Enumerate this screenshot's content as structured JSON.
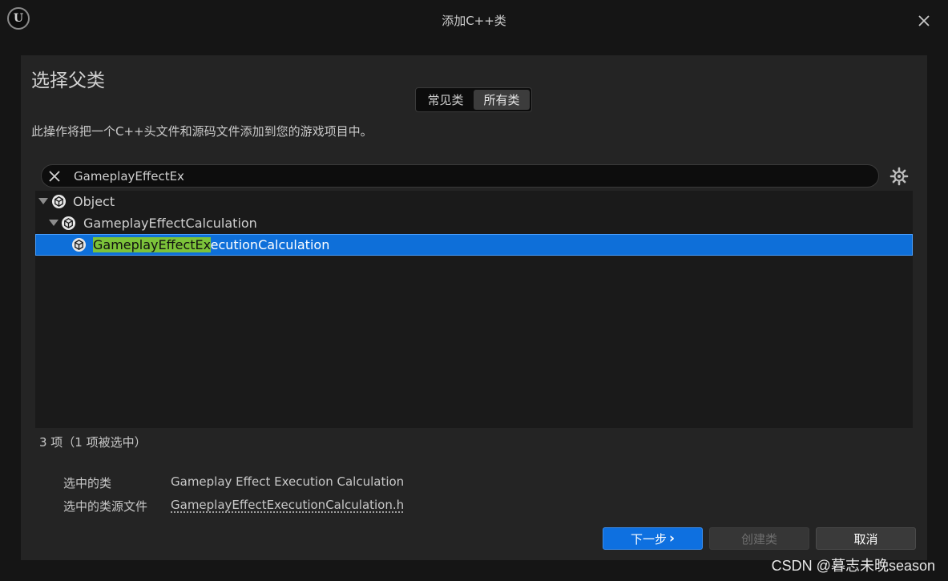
{
  "window": {
    "title": "添加C++类",
    "logo_text": "U"
  },
  "dialog": {
    "heading": "选择父类",
    "tabs": [
      {
        "label": "常见类",
        "active": false
      },
      {
        "label": "所有类",
        "active": true
      }
    ],
    "description": "此操作将把一个C++头文件和源码文件添加到您的游戏项目中。",
    "search": {
      "value": "GameplayEffectEx"
    },
    "tree": [
      {
        "label": "Object",
        "depth": 0,
        "expanded": true,
        "selected": false
      },
      {
        "label": "GameplayEffectCalculation",
        "depth": 1,
        "expanded": true,
        "selected": false
      },
      {
        "label_match": "GameplayEffectEx",
        "label_rest": "ecutionCalculation",
        "depth": 2,
        "expanded": false,
        "selected": true
      }
    ],
    "item_count": "3 项（1 项被选中）",
    "selected_class_label": "选中的类",
    "selected_class_value": "Gameplay Effect Execution Calculation",
    "source_file_label": "选中的类源文件",
    "source_file_value": "GameplayEffectExecutionCalculation.h",
    "buttons": {
      "next": "下一步",
      "next_icon": "›",
      "create": "创建类",
      "cancel": "取消"
    }
  },
  "watermark": "CSDN @暮志未晚season",
  "colors": {
    "accent": "#0e70e0",
    "highlight": "#7cc33a",
    "panel": "#242424"
  }
}
